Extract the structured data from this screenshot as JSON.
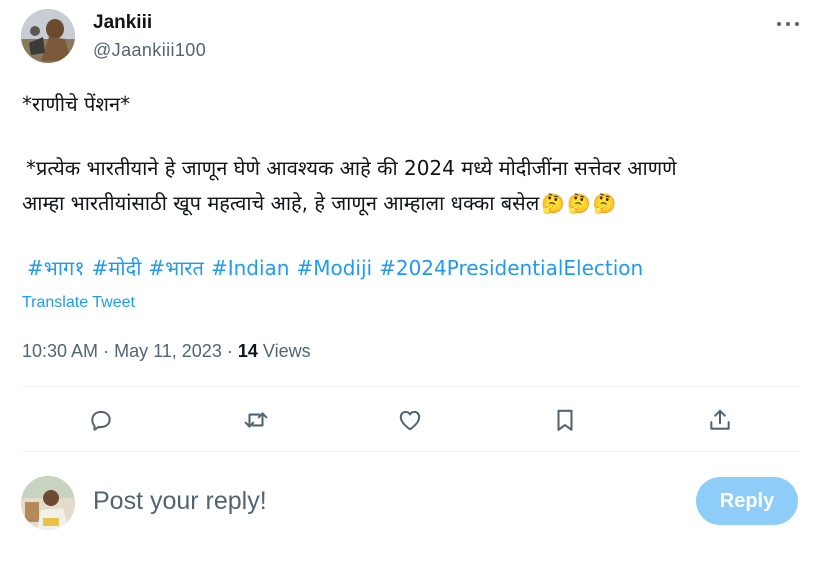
{
  "author": {
    "display_name": "Jankiii",
    "handle": "@Jaankiii100"
  },
  "tweet": {
    "line1": "*राणीचे पेंशन*",
    "line2": "*प्रत्येक भारतीयाने हे जाणून घेणे आवश्यक आहे की 2024 मध्ये मोदीजींना सत्तेवर आणणे",
    "line3": "आम्हा भारतीयांसाठी खूप महत्वाचे आहे, हे जाणून आम्हाला धक्का बसेल",
    "emojis": [
      "🤔",
      "🤔",
      "🤔"
    ],
    "hashtags": [
      "#भाग१",
      "#मोदी",
      "#भारत",
      "#Indian",
      "#Modiji",
      "#2024PresidentialElection"
    ],
    "translate_label": "Translate Tweet",
    "time": "10:30 AM",
    "date": "May 11, 2023",
    "separator": "·",
    "views_count": "14",
    "views_label": "Views"
  },
  "actions": {
    "icons": [
      "reply-icon",
      "retweet-icon",
      "like-icon",
      "bookmark-icon",
      "share-icon"
    ]
  },
  "reply": {
    "placeholder": "Post your reply!",
    "button_label": "Reply"
  },
  "colors": {
    "accent": "#1d9bf0",
    "reply_button_disabled": "#8ecdf8",
    "secondary_text": "#536471"
  }
}
